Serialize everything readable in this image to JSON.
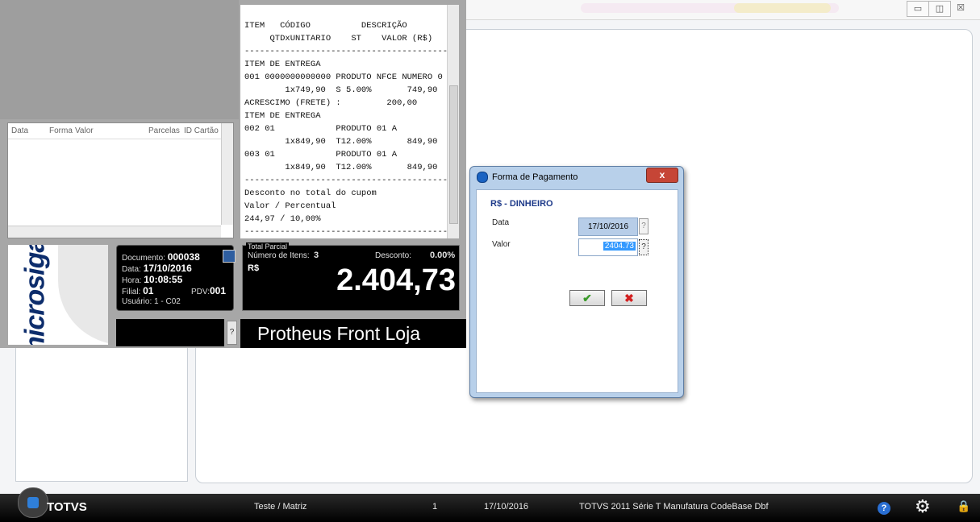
{
  "window": {
    "minimize_glyph": "▭",
    "maximize_glyph": "◫",
    "close_glyph": "☒"
  },
  "payments_list": {
    "columns": [
      "Data",
      "Forma",
      "Valor",
      "Parcelas",
      "ID Cartão"
    ]
  },
  "receipt": {
    "header": "ITEM   CÓDIGO          DESCRIÇÃO\n     QTDxUNITARIO    ST    VALOR (R$)",
    "lines": "----------------------------------------\nITEM DE ENTREGA\n001 0000000000000 PRODUTO NFCE NUMERO 0\n        1x749,90  S 5.00%       749,90\nACRESCIMO (FRETE) :         200,00\nITEM DE ENTREGA\n002 01            PRODUTO 01 A\n        1x849,90  T12.00%       849,90\n003 01            PRODUTO 01 A\n        1x849,90  T12.00%       849,90\n----------------------------------------\nDesconto no total do cupom\nValor / Percentual\n244,97 / 10,00%\n----------------------------------------"
  },
  "logo": {
    "text": "microsiga"
  },
  "document_info": {
    "documento_label": "Documento:",
    "documento_value": "000038",
    "data_label": "Data:",
    "data_value": "17/10/2016",
    "hora_label": "Hora:",
    "hora_value": "10:08:55",
    "filial_label": "Filial:",
    "filial_value": "01",
    "pdv_label": "PDV:",
    "pdv_value": "001",
    "usuario_label": "Usuário:",
    "usuario_value": "1 - C02"
  },
  "total": {
    "group_label": "Total Parcial",
    "items_label": "Número de Itens:",
    "items_value": "3",
    "discount_label": "Desconto:",
    "discount_value": "0.00%",
    "currency": "R$",
    "amount": "2.404,73"
  },
  "help_button": "?",
  "front_title": "Protheus Front Loja",
  "dialog": {
    "title": "Forma de Pagamento",
    "close_glyph": "x",
    "method": "R$ - DINHEIRO",
    "data_label": "Data",
    "data_value": "17/10/2016",
    "valor_label": "Valor",
    "valor_value": "2404.73",
    "help_glyph": "?",
    "ok_glyph": "✔",
    "cancel_glyph": "✖"
  },
  "taskbar": {
    "brand": "TOTVS",
    "company": "Teste / Matriz",
    "number": "1",
    "date": "17/10/2016",
    "product": "TOTVS 2011 Série T Manufatura CodeBase Dbf",
    "help_glyph": "?",
    "settings_glyph": "⚙",
    "lock_glyph": "🔒"
  },
  "colors": {
    "accent_blue": "#1e5fbf",
    "dialog_header": "#b8d0ea",
    "cancel_red": "#d22020",
    "ok_green": "#3a9a2a"
  }
}
